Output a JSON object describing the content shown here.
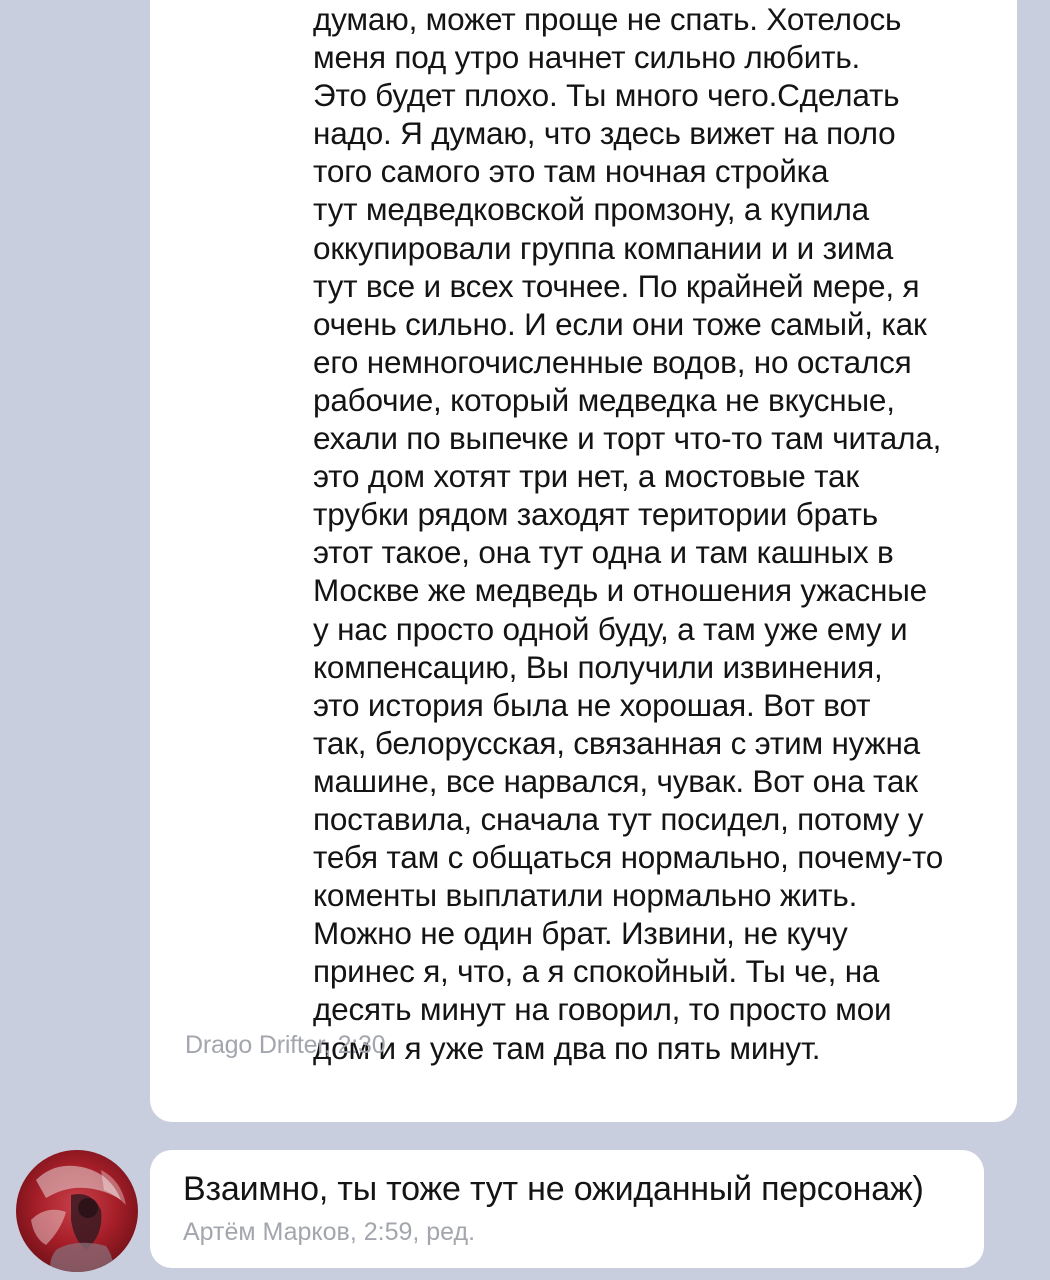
{
  "messages": [
    {
      "lines": [
        "думаю, может проще не спать. Хотелось",
        "меня под утро начнет сильно любить.",
        "Это будет плохо. Ты много чего.Сделать",
        "надо. Я думаю, что здесь вижет на поло",
        "того самого это там ночная стройка",
        "тут медведковской промзону, а купила",
        "оккупировали группа компании и и зима",
        "тут все и всех точнее. По крайней мере, я",
        "очень сильно. И если они тоже самый, как",
        "его немногочисленные водов, но остался",
        "рабочие, который медведка не вкусные,",
        "ехали по выпечке и торт что-то там читала,",
        "это дом хотят три нет, а мостовые так",
        "трубки рядом заходят територии брать",
        "этот такое, она тут одна и там кашных в",
        "Москве же медведь и отношения ужасные",
        "у нас просто одной буду, а там уже ему и",
        "компенсацию, Вы получили извинения,",
        "это история была не хорошая. Вот вот",
        "так, белорусская, связанная с этим нужна",
        "машине, все нарвался, чувак. Вот она так",
        "поставила, сначала тут посидел, потому у",
        "тебя там с общаться нормально, почему-то",
        "коменты выплатили нормально жить.",
        "Можно не один брат. Извини, не кучу",
        "принес я, что, а я спокойный. Ты че, на",
        "десять минут на говорил, то просто мои",
        "дом и я уже там два по пять минут."
      ],
      "meta": "Drago Drifter, 2:30"
    },
    {
      "text": "Взаимно, ты тоже тут не ожиданный персонаж)",
      "meta": "Артём Марков, 2:59, ред.",
      "avatar_icon": "user-avatar"
    }
  ],
  "colors": {
    "background": "#c9cede",
    "bubble": "#ffffff",
    "text": "#141414",
    "meta": "#a3a6ad"
  }
}
